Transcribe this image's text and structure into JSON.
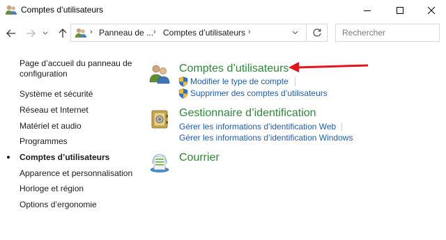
{
  "window": {
    "title": "Comptes d’utilisateurs",
    "icon": "users-icon"
  },
  "address": {
    "crumbs": [
      "Panneau de ...",
      "Comptes d’utilisateurs"
    ],
    "separator": "›",
    "search_placeholder": "Rechercher"
  },
  "leftnav": {
    "items": [
      {
        "label_line1": "Page d’accueil du panneau de",
        "label_line2": "configuration",
        "current": false
      },
      {
        "label": "Système et sécurité",
        "current": false
      },
      {
        "label": "Réseau et Internet",
        "current": false
      },
      {
        "label": "Matériel et audio",
        "current": false
      },
      {
        "label": "Programmes",
        "current": false
      },
      {
        "label": "Comptes d’utilisateurs",
        "current": true
      },
      {
        "label": "Apparence et personnalisation",
        "current": false
      },
      {
        "label": "Horloge et région",
        "current": false
      },
      {
        "label": "Options d’ergonomie",
        "current": false
      }
    ]
  },
  "categories": [
    {
      "title": "Comptes d’utilisateurs",
      "icon": "user-accounts-icon",
      "links": [
        {
          "label": "Modifier le type de compte",
          "shield": true
        },
        {
          "label": "Supprimer des comptes d’utilisateurs",
          "shield": true
        }
      ]
    },
    {
      "title": "Gestionnaire d’identification",
      "icon": "credential-manager-icon",
      "links": [
        {
          "label": "Gérer les informations d’identification Web",
          "shield": false
        },
        {
          "label": "Gérer les informations d’identification Windows",
          "shield": false
        }
      ]
    },
    {
      "title": "Courrier",
      "icon": "mail-icon",
      "links": []
    }
  ],
  "colors": {
    "category_title": "#2b8a34",
    "link": "#1c5dbb",
    "annotation_arrow": "#e3141b"
  }
}
